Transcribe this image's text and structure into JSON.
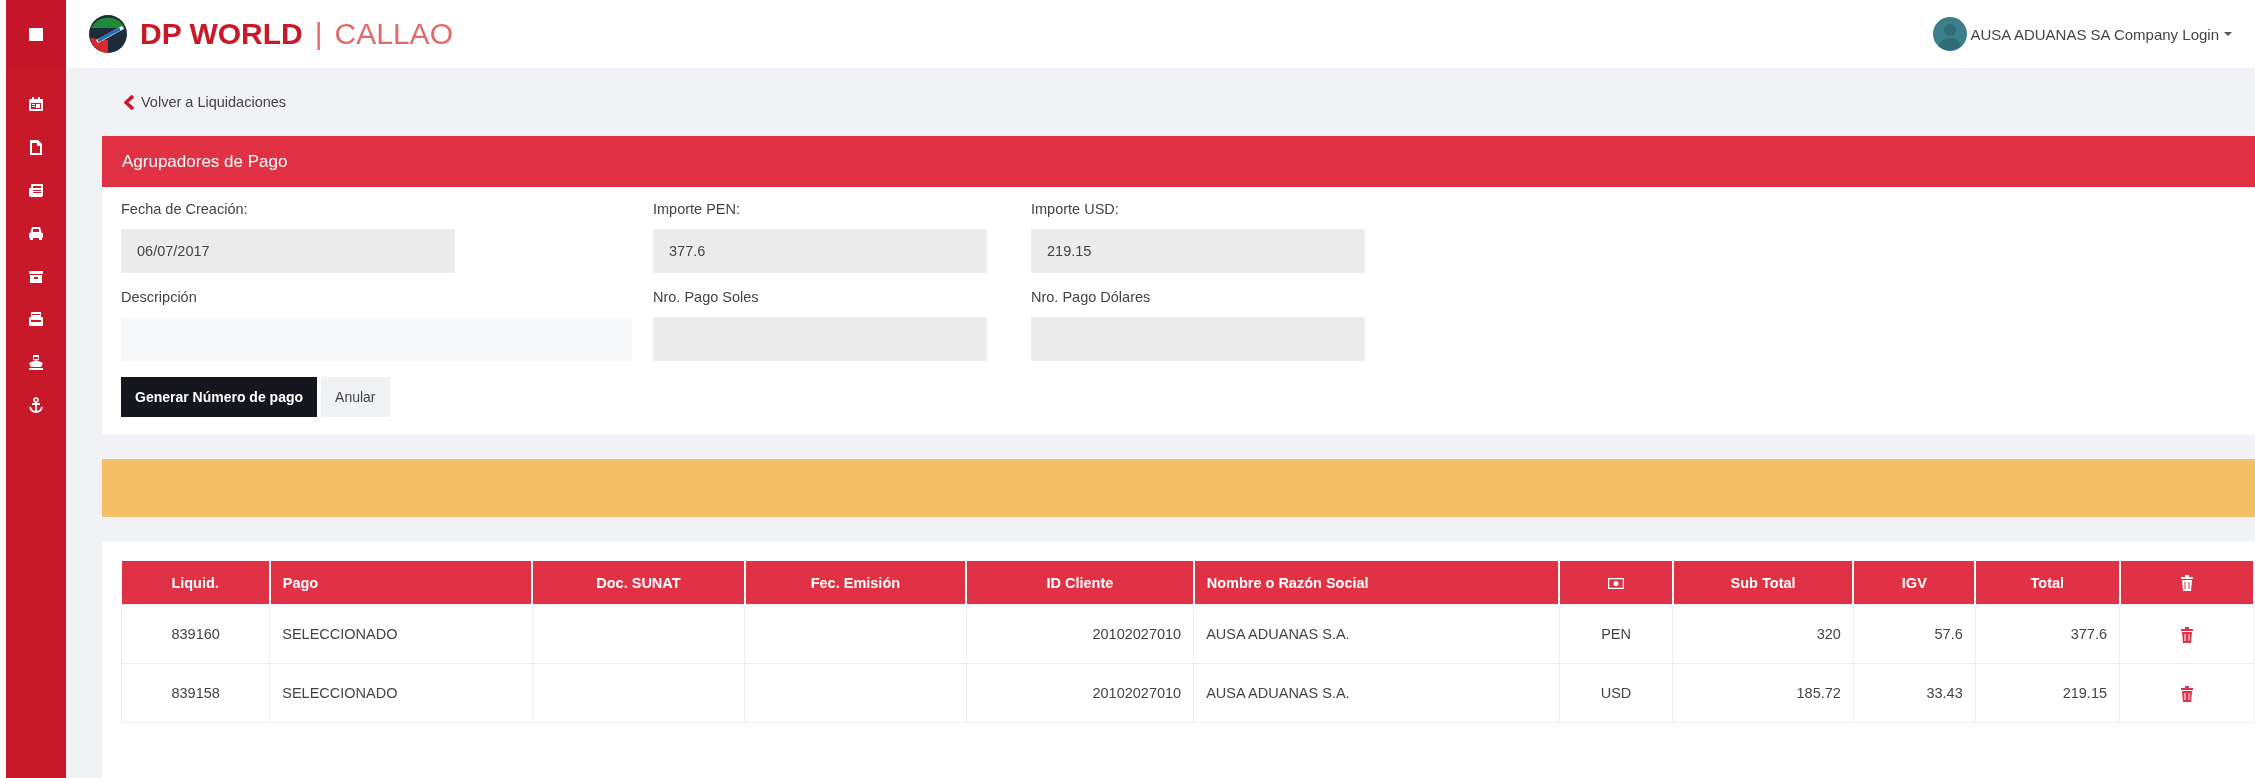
{
  "header": {
    "brand": "DP WORLD",
    "separator": "|",
    "location": "CALLAO",
    "user": "AUSA ADUANAS SA Company Login"
  },
  "back_link": "Volver a Liquidaciones",
  "panel": {
    "title": "Agrupadores de Pago",
    "fields": [
      {
        "label": "Fecha de Creación:",
        "value": "06/07/2017",
        "disabled": true,
        "kind": "narrow"
      },
      {
        "label": "Importe PEN:",
        "value": "377.6",
        "disabled": true,
        "kind": "narrow"
      },
      {
        "label": "Importe USD:",
        "value": "219.15",
        "disabled": true,
        "kind": "narrow"
      },
      {
        "label": "Descripción",
        "disabled": false,
        "kind": "wide"
      },
      {
        "label": "Nro. Pago Soles",
        "disabled": true,
        "kind": "narrow"
      },
      {
        "label": "Nro. Pago Dólares",
        "disabled": true,
        "kind": "narrow"
      }
    ],
    "buttons": [
      {
        "label": "Generar Número de pago",
        "kind": "primary"
      },
      {
        "label": "Anular",
        "kind": "secondary"
      }
    ]
  },
  "table": {
    "columns": [
      {
        "kind": "text",
        "label": "Liquid."
      },
      {
        "kind": "text",
        "label": "Pago"
      },
      {
        "kind": "text",
        "label": "Doc. SUNAT"
      },
      {
        "kind": "text",
        "label": "Fec. Emisión"
      },
      {
        "kind": "text",
        "label": "ID Cliente"
      },
      {
        "kind": "text",
        "label": "Nombre o Razón Social"
      },
      {
        "kind": "money-icon"
      },
      {
        "kind": "text",
        "label": "Sub Total"
      },
      {
        "kind": "text",
        "label": "IGV"
      },
      {
        "kind": "text",
        "label": "Total"
      },
      {
        "kind": "trash-icon"
      }
    ],
    "rows": [
      {
        "liquid": "839160",
        "pago": "SELECCIONADO",
        "id_cliente": "20102027010",
        "nombre": "AUSA ADUANAS S.A.",
        "moneda": "PEN",
        "sub_total": "320",
        "igv": "57.6",
        "total": "377.6"
      },
      {
        "liquid": "839158",
        "pago": "SELECCIONADO",
        "id_cliente": "20102027010",
        "nombre": "AUSA ADUANAS S.A.",
        "moneda": "USD",
        "sub_total": "185.72",
        "igv": "33.43",
        "total": "219.15"
      }
    ]
  }
}
